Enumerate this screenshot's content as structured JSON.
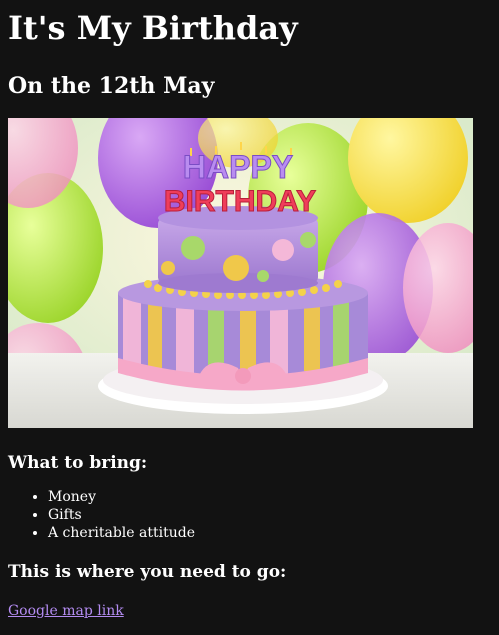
{
  "page": {
    "title": "It's My Birthday",
    "date": "On the 12th May"
  },
  "hero_image": {
    "alt": "Birthday cake",
    "cake_text_top": "HAPPY",
    "cake_text_bottom": "BIRTHDAY"
  },
  "bring": {
    "heading": "What to bring:",
    "items": [
      "Money",
      "Gifts",
      "A cheritable attitude"
    ]
  },
  "location": {
    "heading": "This is where you need to go:",
    "link_text": "Google map link"
  },
  "colors": {
    "background": "#121212",
    "text": "#ffffff",
    "link": "#b48cf2"
  }
}
